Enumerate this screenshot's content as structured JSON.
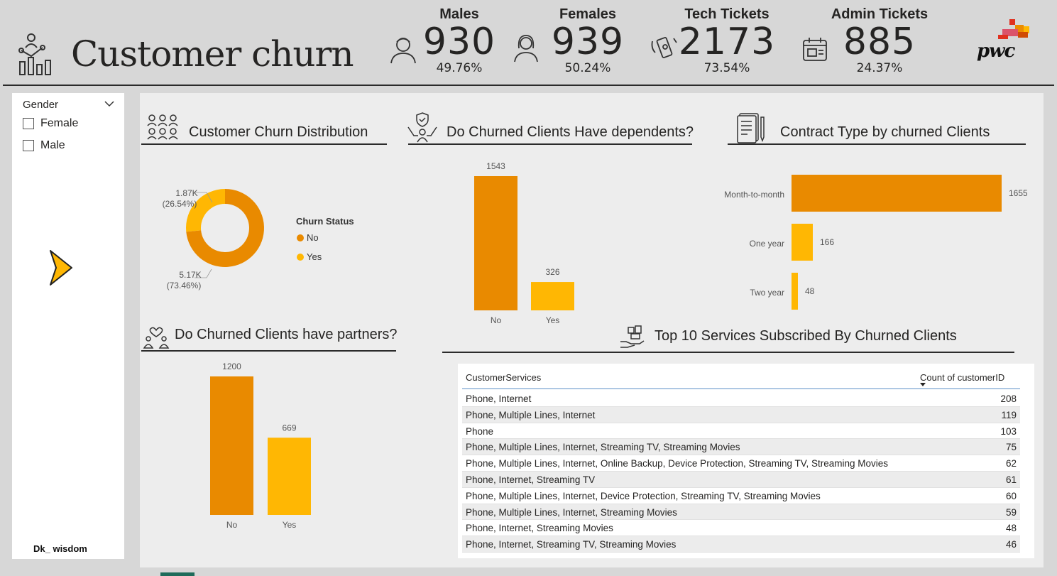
{
  "header": {
    "title": "Customer churn",
    "kpis": [
      {
        "label": "Males",
        "value": "930",
        "pct": "49.76%",
        "icon": "male-user-icon"
      },
      {
        "label": "Females",
        "value": "939",
        "pct": "50.24%",
        "icon": "female-user-icon"
      },
      {
        "label": "Tech Tickets",
        "value": "2173",
        "pct": "73.54%",
        "icon": "tech-support-icon"
      },
      {
        "label": "Admin Tickets",
        "value": "885",
        "pct": "24.37%",
        "icon": "admin-calendar-icon"
      }
    ],
    "logo_text": "pwc"
  },
  "filter": {
    "title": "Gender",
    "options": [
      "Female",
      "Male"
    ],
    "author": "Dk_ wisdom"
  },
  "sections": {
    "churn_distribution": "Customer Churn Distribution",
    "dependents": "Do Churned Clients Have dependents?",
    "contract": "Contract Type by churned Clients",
    "partners": "Do Churned Clients have partners?",
    "services": "Top 10   Services Subscribed By Churned Clients"
  },
  "colors": {
    "primary": "#e98a00",
    "secondary": "#ffb703"
  },
  "chart_data": [
    {
      "id": "churn_distribution",
      "type": "pie",
      "title": "Customer Churn Distribution",
      "legend_title": "Churn Status",
      "legend_position": "right",
      "slices": [
        {
          "name": "No",
          "value": 5170,
          "label": "5.17K",
          "pct_label": "(73.46%)"
        },
        {
          "name": "Yes",
          "value": 1870,
          "label": "1.87K",
          "pct_label": "(26.54%)"
        }
      ]
    },
    {
      "id": "dependents",
      "type": "bar",
      "title": "Do Churned Clients Have dependents?",
      "categories": [
        "No",
        "Yes"
      ],
      "values": [
        1543,
        326
      ]
    },
    {
      "id": "contract",
      "type": "bar",
      "orientation": "horizontal",
      "title": "Contract Type by churned Clients",
      "categories": [
        "Month-to-month",
        "One year",
        "Two year"
      ],
      "values": [
        1655,
        166,
        48
      ]
    },
    {
      "id": "partners",
      "type": "bar",
      "title": "Do Churned Clients have partners?",
      "categories": [
        "No",
        "Yes"
      ],
      "values": [
        1200,
        669
      ]
    },
    {
      "id": "services",
      "type": "table",
      "title": "Top 10   Services Subscribed By Churned Clients",
      "columns": [
        "CustomerServices",
        "Count of customerID"
      ],
      "rows": [
        [
          "Phone, Internet",
          208
        ],
        [
          "Phone, Multiple Lines, Internet",
          119
        ],
        [
          "Phone",
          103
        ],
        [
          "Phone, Multiple Lines, Internet, Streaming TV, Streaming Movies",
          75
        ],
        [
          "Phone, Multiple Lines, Internet, Online Backup, Device Protection, Streaming TV, Streaming Movies",
          62
        ],
        [
          "Phone, Internet, Streaming TV",
          61
        ],
        [
          "Phone, Multiple Lines, Internet, Device Protection, Streaming TV, Streaming Movies",
          60
        ],
        [
          "Phone, Multiple Lines, Internet, Streaming Movies",
          59
        ],
        [
          "Phone, Internet, Streaming Movies",
          48
        ],
        [
          "Phone, Internet, Streaming TV, Streaming Movies",
          46
        ]
      ]
    }
  ]
}
